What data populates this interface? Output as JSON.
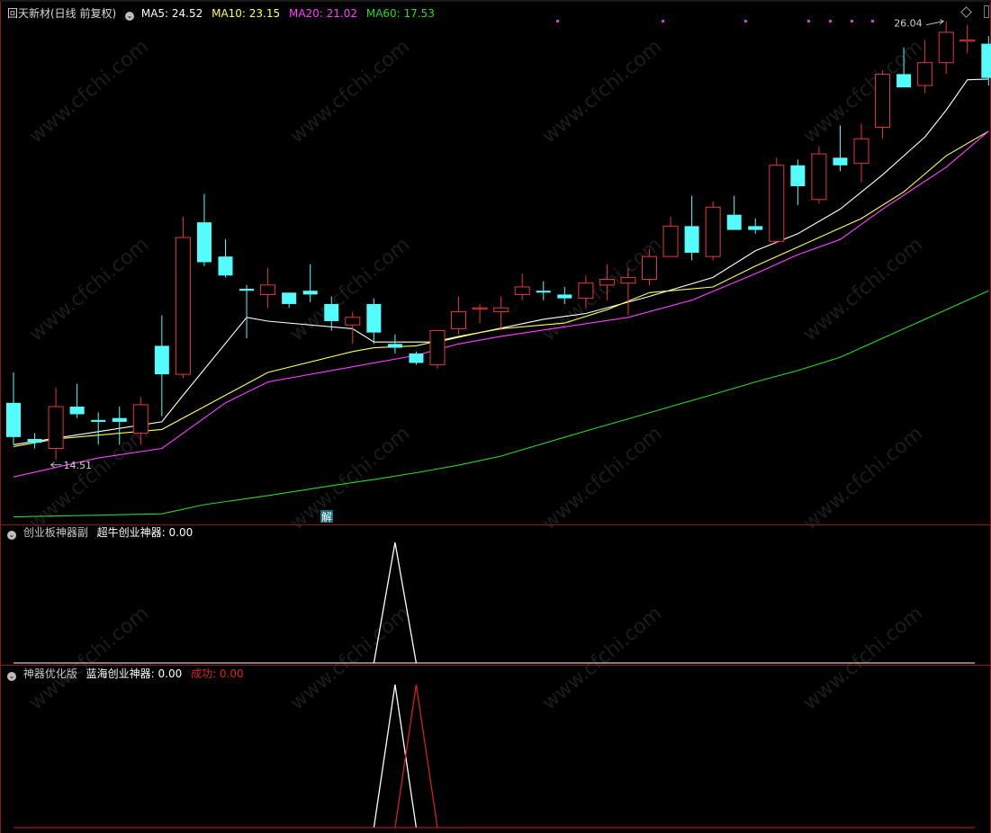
{
  "main_header": {
    "title": "回天新材(日线 前复权)",
    "ma5": "MA5: 24.52",
    "ma10": "MA10: 23.15",
    "ma20": "MA20: 21.02",
    "ma60": "MA60: 17.53"
  },
  "sub1_header": {
    "title": "创业板神器副",
    "series": "超牛创业神器: 0.00"
  },
  "sub2_header": {
    "title": "神器优化版",
    "series1": "蓝海创业神器: 0.00",
    "series2": "成功: 0.00"
  },
  "annotations": {
    "high": "26.04",
    "low": "14.51",
    "marker": "解"
  },
  "watermark": "www.cfchi.com",
  "colors": {
    "up": "#e23a3a",
    "down": "#54fcfc",
    "ma5": "#ffffff",
    "ma10": "#ffff54",
    "ma20": "#ff40ff",
    "ma60": "#28d828",
    "border": "#8b1a1a"
  },
  "chart_data": [
    {
      "type": "candlestick",
      "title": "回天新材(日线 前复权)",
      "price_range": [
        12.8,
        26.6
      ],
      "candles": [
        {
          "o": 16.0,
          "h": 16.8,
          "l": 14.9,
          "c": 15.1
        },
        {
          "o": 15.05,
          "h": 15.2,
          "l": 14.8,
          "c": 14.95
        },
        {
          "o": 14.8,
          "h": 16.4,
          "l": 14.5,
          "c": 15.9
        },
        {
          "o": 15.9,
          "h": 16.5,
          "l": 15.6,
          "c": 15.7
        },
        {
          "o": 15.55,
          "h": 15.75,
          "l": 14.9,
          "c": 15.5
        },
        {
          "o": 15.6,
          "h": 15.9,
          "l": 14.9,
          "c": 15.5
        },
        {
          "o": 15.2,
          "h": 16.15,
          "l": 14.9,
          "c": 15.95
        },
        {
          "o": 17.5,
          "h": 18.3,
          "l": 15.65,
          "c": 16.75
        },
        {
          "o": 16.75,
          "h": 20.9,
          "l": 16.65,
          "c": 20.35
        },
        {
          "o": 20.75,
          "h": 21.5,
          "l": 19.6,
          "c": 19.7
        },
        {
          "o": 19.85,
          "h": 20.3,
          "l": 19.3,
          "c": 19.35
        },
        {
          "o": 19.0,
          "h": 19.1,
          "l": 17.7,
          "c": 18.95
        },
        {
          "o": 18.85,
          "h": 19.55,
          "l": 18.5,
          "c": 19.1
        },
        {
          "o": 18.9,
          "h": 18.9,
          "l": 18.5,
          "c": 18.6
        },
        {
          "o": 18.95,
          "h": 19.65,
          "l": 18.65,
          "c": 18.85
        },
        {
          "o": 18.6,
          "h": 18.8,
          "l": 17.9,
          "c": 18.15
        },
        {
          "o": 18.05,
          "h": 18.4,
          "l": 17.55,
          "c": 18.25
        },
        {
          "o": 18.6,
          "h": 18.75,
          "l": 17.55,
          "c": 17.85
        },
        {
          "o": 17.55,
          "h": 17.8,
          "l": 17.3,
          "c": 17.45
        },
        {
          "o": 17.3,
          "h": 17.35,
          "l": 17.0,
          "c": 17.05
        },
        {
          "o": 17.0,
          "h": 17.9,
          "l": 16.9,
          "c": 17.9
        },
        {
          "o": 17.95,
          "h": 18.8,
          "l": 17.8,
          "c": 18.4
        },
        {
          "o": 18.5,
          "h": 18.6,
          "l": 18.1,
          "c": 18.5
        },
        {
          "o": 18.4,
          "h": 18.8,
          "l": 17.9,
          "c": 18.5
        },
        {
          "o": 18.85,
          "h": 19.4,
          "l": 18.7,
          "c": 19.05
        },
        {
          "o": 18.95,
          "h": 19.2,
          "l": 18.7,
          "c": 18.9
        },
        {
          "o": 18.85,
          "h": 19.05,
          "l": 18.6,
          "c": 18.75
        },
        {
          "o": 18.75,
          "h": 19.35,
          "l": 18.5,
          "c": 19.15
        },
        {
          "o": 19.1,
          "h": 19.65,
          "l": 18.7,
          "c": 19.25
        },
        {
          "o": 19.15,
          "h": 19.55,
          "l": 18.3,
          "c": 19.3
        },
        {
          "o": 19.25,
          "h": 20.05,
          "l": 19.1,
          "c": 19.85
        },
        {
          "o": 19.85,
          "h": 20.9,
          "l": 19.85,
          "c": 20.65
        },
        {
          "o": 20.65,
          "h": 21.45,
          "l": 19.75,
          "c": 19.95
        },
        {
          "o": 19.85,
          "h": 21.3,
          "l": 19.75,
          "c": 21.15
        },
        {
          "o": 20.95,
          "h": 21.45,
          "l": 20.65,
          "c": 20.55
        },
        {
          "o": 20.65,
          "h": 20.85,
          "l": 20.45,
          "c": 20.55
        },
        {
          "o": 20.25,
          "h": 22.45,
          "l": 20.2,
          "c": 22.25
        },
        {
          "o": 22.25,
          "h": 22.4,
          "l": 21.2,
          "c": 21.7
        },
        {
          "o": 21.35,
          "h": 22.75,
          "l": 21.25,
          "c": 22.55
        },
        {
          "o": 22.45,
          "h": 23.3,
          "l": 22.1,
          "c": 22.25
        },
        {
          "o": 22.3,
          "h": 23.35,
          "l": 21.8,
          "c": 22.95
        },
        {
          "o": 23.25,
          "h": 24.75,
          "l": 22.95,
          "c": 24.65
        },
        {
          "o": 24.65,
          "h": 25.35,
          "l": 24.35,
          "c": 24.3
        },
        {
          "o": 24.35,
          "h": 25.55,
          "l": 24.15,
          "c": 24.95
        },
        {
          "o": 24.95,
          "h": 26.04,
          "l": 24.65,
          "c": 25.75
        },
        {
          "o": 25.55,
          "h": 25.95,
          "l": 25.2,
          "c": 25.55
        },
        {
          "o": 25.45,
          "h": 25.65,
          "l": 24.35,
          "c": 24.55
        }
      ],
      "ma_series": [
        {
          "name": "MA5",
          "points": [
            [
              0,
              14.9
            ],
            [
              7,
              15.5
            ],
            [
              8,
              16.2
            ],
            [
              11,
              18.25
            ],
            [
              12,
              18.15
            ],
            [
              16,
              17.95
            ],
            [
              17,
              17.6
            ],
            [
              20,
              17.6
            ],
            [
              22,
              17.85
            ],
            [
              25,
              18.2
            ],
            [
              27,
              18.35
            ],
            [
              30,
              18.8
            ],
            [
              33,
              19.3
            ],
            [
              35,
              20.0
            ],
            [
              37,
              20.45
            ],
            [
              39,
              21.1
            ],
            [
              41,
              22.0
            ],
            [
              43,
              23.0
            ],
            [
              44,
              23.7
            ],
            [
              45,
              24.5
            ],
            [
              46,
              24.52
            ]
          ]
        },
        {
          "name": "MA10",
          "points": [
            [
              0,
              14.85
            ],
            [
              2,
              15.05
            ],
            [
              7,
              15.3
            ],
            [
              9,
              15.9
            ],
            [
              12,
              16.8
            ],
            [
              16,
              17.35
            ],
            [
              17,
              17.45
            ],
            [
              19,
              17.5
            ],
            [
              21,
              17.75
            ],
            [
              23,
              17.95
            ],
            [
              26,
              18.1
            ],
            [
              28,
              18.45
            ],
            [
              30,
              18.9
            ],
            [
              33,
              19.05
            ],
            [
              35,
              19.6
            ],
            [
              37,
              20.1
            ],
            [
              40,
              20.85
            ],
            [
              42,
              21.55
            ],
            [
              44,
              22.5
            ],
            [
              46,
              23.15
            ]
          ]
        },
        {
          "name": "MA20",
          "points": [
            [
              0,
              14.05
            ],
            [
              4,
              14.55
            ],
            [
              7,
              14.8
            ],
            [
              8,
              15.2
            ],
            [
              10,
              16.0
            ],
            [
              12,
              16.55
            ],
            [
              16,
              16.95
            ],
            [
              19,
              17.25
            ],
            [
              21,
              17.55
            ],
            [
              23,
              17.75
            ],
            [
              26,
              18.0
            ],
            [
              29,
              18.25
            ],
            [
              32,
              18.7
            ],
            [
              35,
              19.4
            ],
            [
              37,
              19.9
            ],
            [
              39,
              20.3
            ],
            [
              41,
              21.1
            ],
            [
              44,
              22.2
            ],
            [
              46,
              23.15
            ]
          ]
        },
        {
          "name": "MA60",
          "points": [
            [
              0,
              13.0
            ],
            [
              7,
              13.08
            ],
            [
              9,
              13.32
            ],
            [
              12,
              13.56
            ],
            [
              15,
              13.82
            ],
            [
              17,
              13.98
            ],
            [
              19,
              14.16
            ],
            [
              21,
              14.36
            ],
            [
              23,
              14.6
            ],
            [
              25,
              14.93
            ],
            [
              27,
              15.26
            ],
            [
              29,
              15.58
            ],
            [
              31,
              15.9
            ],
            [
              33,
              16.22
            ],
            [
              35,
              16.55
            ],
            [
              37,
              16.85
            ],
            [
              39,
              17.2
            ],
            [
              41,
              17.7
            ],
            [
              43,
              18.2
            ],
            [
              45,
              18.7
            ],
            [
              46,
              18.95
            ]
          ]
        }
      ]
    },
    {
      "type": "line",
      "title": "创业板神器副",
      "ylim": [
        0,
        1
      ],
      "series": [
        {
          "name": "超牛创业神器",
          "color": "#ffffff",
          "points": [
            [
              17.0,
              0
            ],
            [
              18.0,
              1
            ],
            [
              19.0,
              0
            ]
          ]
        }
      ]
    },
    {
      "type": "line",
      "title": "神器优化版",
      "ylim": [
        0,
        1
      ],
      "series": [
        {
          "name": "蓝海创业神器",
          "color": "#ffffff",
          "points": [
            [
              17.0,
              0
            ],
            [
              18.0,
              1
            ],
            [
              19.0,
              0
            ]
          ]
        },
        {
          "name": "成功",
          "color": "#d02020",
          "points": [
            [
              18.0,
              0
            ],
            [
              19.0,
              1
            ],
            [
              20.0,
              0
            ]
          ]
        }
      ]
    }
  ]
}
